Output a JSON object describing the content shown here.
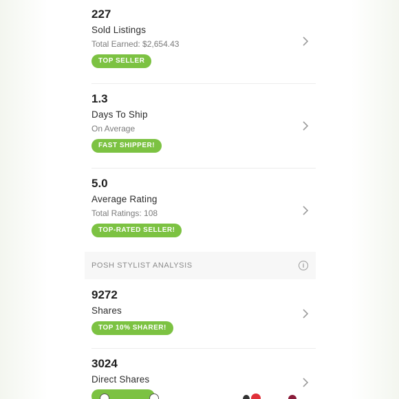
{
  "stats": [
    {
      "value": "227",
      "title": "Sold Listings",
      "subtitle": "Total Earned: $2,654.43",
      "badge": "TOP SELLER"
    },
    {
      "value": "1.3",
      "title": "Days To Ship",
      "subtitle": "On Average",
      "badge": "FAST SHIPPER!"
    },
    {
      "value": "5.0",
      "title": "Average Rating",
      "subtitle": "Total Ratings: 108",
      "badge": "TOP-RATED SELLER!"
    }
  ],
  "section": {
    "label": "POSH STYLIST ANALYSIS",
    "icon": "info-icon"
  },
  "stylist_stats": [
    {
      "value": "9272",
      "title": "Shares",
      "badge": "TOP 10% SHARER!"
    },
    {
      "value": "3024",
      "title": "Direct Shares"
    }
  ],
  "colors": {
    "badge": "#7cc242",
    "notification": "#e0313a",
    "divider": "#ececec"
  }
}
